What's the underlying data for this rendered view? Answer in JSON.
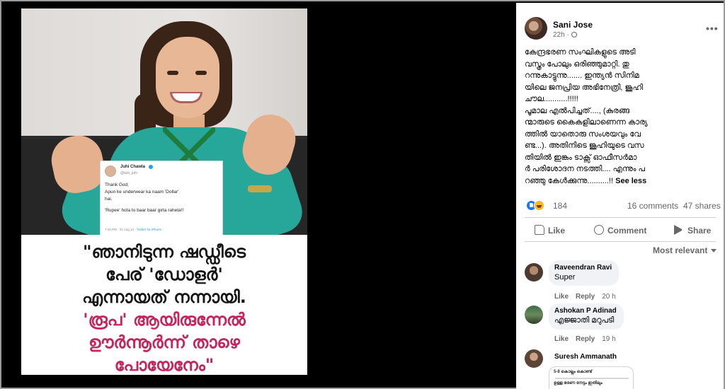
{
  "media": {
    "tweet": {
      "name": "Juhi Chawla",
      "handle": "@iam_juhi",
      "line1": "Thank God,",
      "line2": "Apun ke underwear ka naam 'Dollar'",
      "line3": "hai.",
      "line4": "'Rupee' hota to baar baar girta raheta!!",
      "meta": "7:40 PM · 21 Aug 13 · ",
      "app": "Twitter for iPhone"
    },
    "caption": {
      "line1": "\"ഞാനിടുന്ന ഷഡ്ഡീടെ",
      "line2": "പേര് 'ഡോളര്‍'",
      "line3": "എന്നായത് നന്നായി.",
      "line4": "'രൂപ' ആയിരുന്നേല്‍",
      "line5": "ഊര്‍ന്നൂര്‍ന്ന് താഴെ",
      "line6": "പോയേനേം\""
    }
  },
  "post": {
    "author": "Sani Jose",
    "time": "22h ·",
    "text": {
      "p1_l1": "കേന്ദ്രഭരണ സംഘികളുടെ അടി",
      "p1_l2": "വസ്ത്രം പോലും ഒരിഞ്ഞുമാറ്റി. തു",
      "p1_l3": "റന്നുകാട്ടുന്നു....... ഇന്ത്യൻ സിനിമ",
      "p1_l4": "യിലെ ജനപ്രിയ അഭിനേത്രി, ജൂഹി",
      "p1_l5": "ചൗല...........!!!!!",
      "p2_l1": "പൂമാല എൽപിച്ചത്...., (കുരങ്ങ",
      "p2_l2": "ന്മാരുടെ കൈകളിലാണെന്ന കാര്യ",
      "p2_l3": "ത്തിൽ യാതൊരു സംശയവും വേ",
      "p2_l4": "ണ്ട...). അതിനിടെ ജൂഹിയുടെ വസ",
      "p2_l5": "തിയിൽ ഇങ്കം ടാക്സ് ഓഫീസർമാ",
      "p2_l6": "ർ പരിശോദന നടത്തി.... എന്നും പ",
      "p2_l7": "റഞ്ഞു കേൾക്കുന്നു..........!!",
      "see_less": "See less"
    },
    "reactions_count": "184",
    "comments_count": "16 comments",
    "shares_count": "47 shares",
    "actions": {
      "like": "Like",
      "comment": "Comment",
      "share": "Share"
    },
    "sort_label": "Most relevant"
  },
  "comments": [
    {
      "name": "Raveendran Ravi",
      "text": "Super",
      "like": "Like",
      "reply": "Reply",
      "time": "20 h"
    },
    {
      "name": "Ashokan P Adinad",
      "text": "എജ്ജാതി മറുപടി",
      "like": "Like",
      "reply": "Reply",
      "time": "19 h"
    },
    {
      "name": "Suresh Ammanath",
      "sticker_line1": "5-8 കൊല്ലം കൊണ്ട്",
      "sticker_line2": "ഉള്ള ഭരണ നേട്ടം ഇതിലും"
    }
  ],
  "colors": {
    "caption_black": "#151515",
    "caption_pink": "#c6245a",
    "kurta": "#27a79a",
    "fb_blue": "#1877f2",
    "meta_gray": "#65676b"
  }
}
